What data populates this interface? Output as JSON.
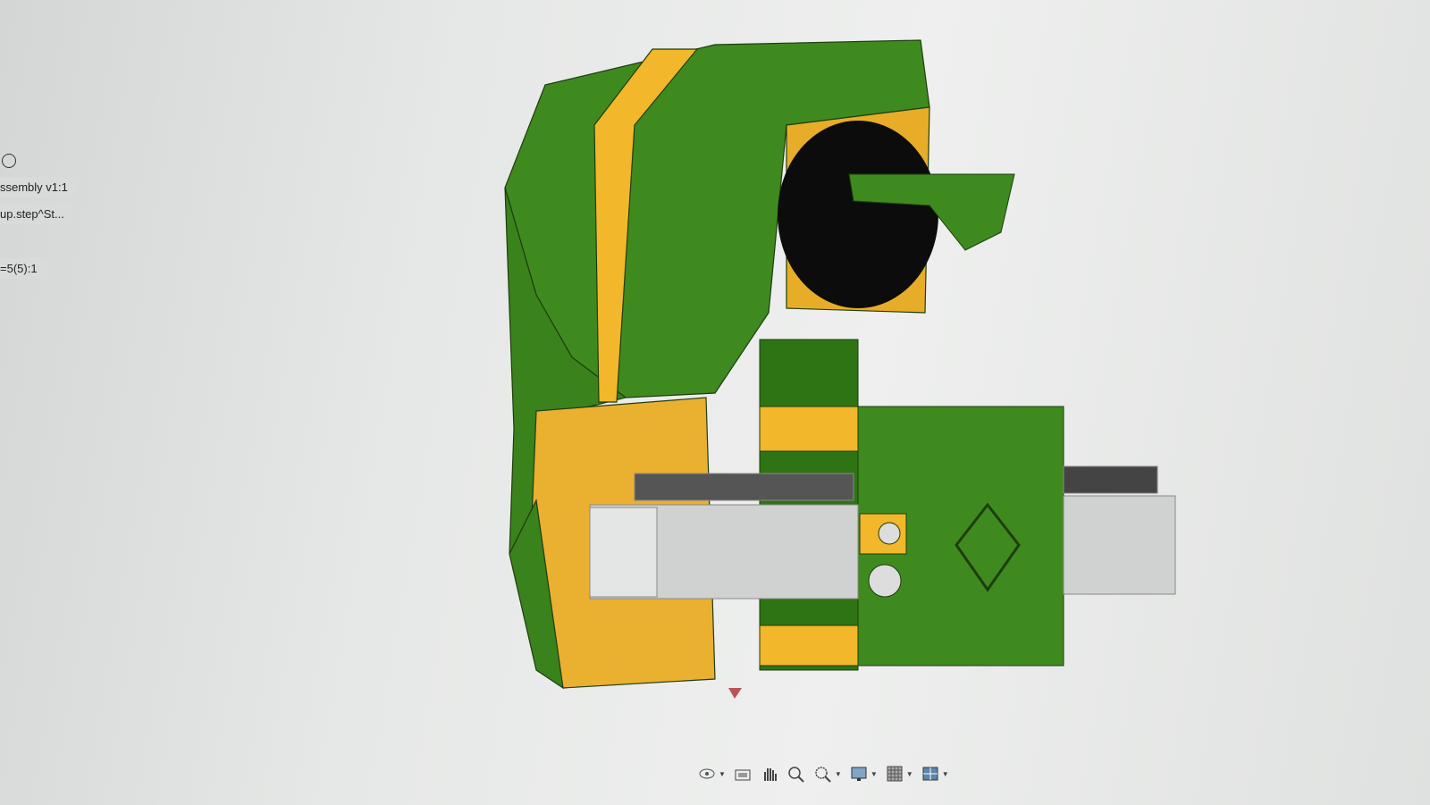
{
  "browser": {
    "items": [
      {
        "label": "ssembly v1:1"
      },
      {
        "label": "up.step^St..."
      },
      {
        "label": "=5(5):1"
      }
    ]
  },
  "colors": {
    "green": "#3f8a1f",
    "yellow": "#f2b72a",
    "dark_green": "#2c6a14",
    "rail": "#cfd2d0"
  },
  "navbar": {
    "tools": [
      {
        "icon": "orbit-icon",
        "has_menu": true
      },
      {
        "icon": "look-at-icon",
        "has_menu": false
      },
      {
        "icon": "pan-icon",
        "has_menu": false
      },
      {
        "icon": "zoom-icon",
        "has_menu": false
      },
      {
        "icon": "zoom-window-icon",
        "has_menu": true
      },
      {
        "icon": "display-settings-icon",
        "has_menu": true
      },
      {
        "icon": "grid-icon",
        "has_menu": true
      },
      {
        "icon": "viewports-icon",
        "has_menu": true
      }
    ]
  }
}
